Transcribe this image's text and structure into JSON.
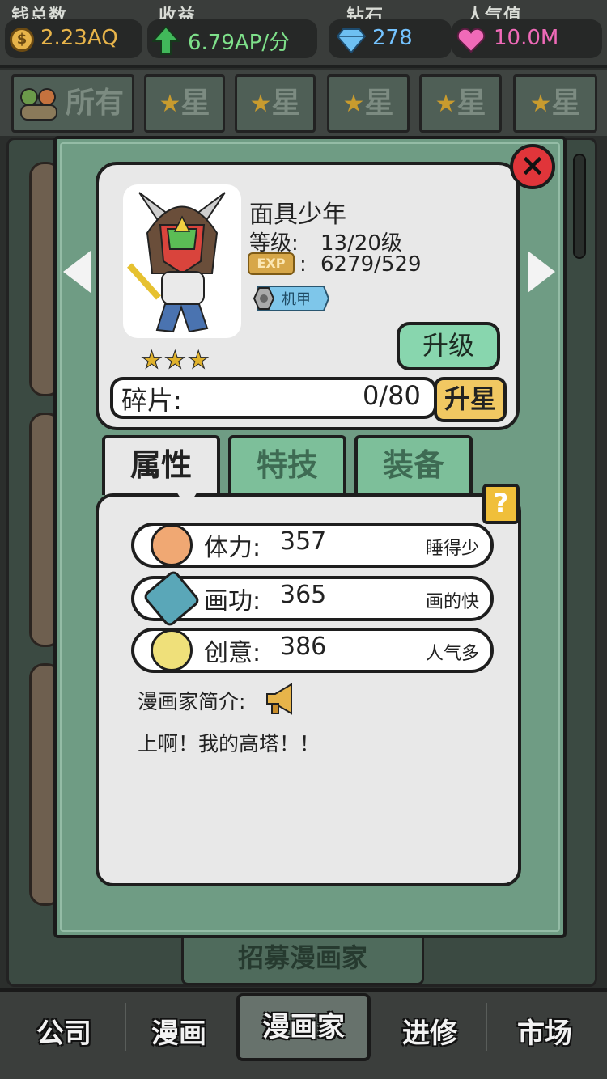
{
  "topbar": {
    "money": {
      "label": "钱总数",
      "value": "2.23AQ",
      "icon": "coin-icon",
      "color": "#e7b44a"
    },
    "income": {
      "label": "收益",
      "value": "6.79AP/分",
      "icon": "up-arrow-icon",
      "color": "#7ee08a"
    },
    "diamond": {
      "label": "钻石",
      "value": "278",
      "icon": "diamond-icon",
      "color": "#74c3ff"
    },
    "popularity": {
      "label": "人气值",
      "value": "10.0M",
      "icon": "heart-icon",
      "color": "#f06ab8"
    }
  },
  "filter_tabs": {
    "all": "所有",
    "star_label": "星"
  },
  "recruit_button": "招募漫画家",
  "artist": {
    "name": "面具少年",
    "level_label": "等级:",
    "level_value": "13/20级",
    "exp_badge": "EXP",
    "exp_sep": ":",
    "exp_value": "6279/529",
    "tag": "机甲",
    "stars": 3,
    "upgrade_label": "升级",
    "fragments_label": "碎片:",
    "fragments_value": "0/80",
    "star_up_label": "升星"
  },
  "detail_tabs": {
    "attributes": "属性",
    "skills": "特技",
    "equipment": "装备"
  },
  "help_label": "?",
  "attributes": [
    {
      "name": "体力:",
      "value": "357",
      "desc": "睡得少",
      "icon": "face-icon"
    },
    {
      "name": "画功:",
      "value": "365",
      "desc": "画的快",
      "icon": "pencil-icon"
    },
    {
      "name": "创意:",
      "value": "386",
      "desc": "人气多",
      "icon": "lightbulb-icon"
    }
  ],
  "intro": {
    "label": "漫画家简介:",
    "text": "上啊！我的高塔！！"
  },
  "bottom_nav": [
    "公司",
    "漫画",
    "漫画家",
    "进修",
    "市场"
  ]
}
